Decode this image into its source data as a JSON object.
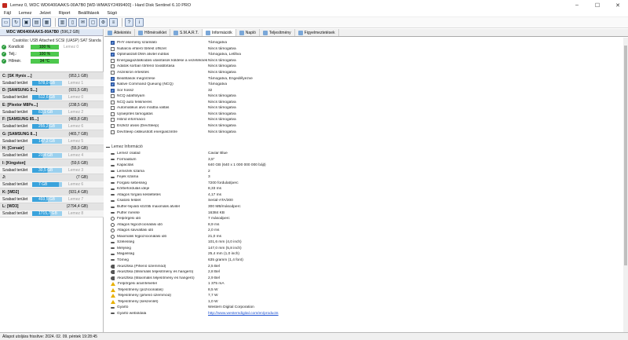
{
  "title": "Lemez 0, WDC WD6400AAKS-00A7B0 [WD-WMASY2499400]  -  Hard Disk Sentinel 6.10 PRO",
  "menu": [
    "Fájl",
    "Lemez",
    "Jelzet",
    "Riport",
    "Beállítások",
    "Súgó"
  ],
  "toolbar_icons": [
    "disk-icon",
    "refresh-icon",
    "save-icon",
    "chart-icon",
    "grid-icon",
    "report-icon",
    "book-icon",
    "mail-icon",
    "monitor-icon",
    "settings-icon",
    "list-icon",
    "help-icon",
    "info-icon"
  ],
  "disk": {
    "name": "WDC WD6400AAKS-00A7B0",
    "size": "(596,2 GB)",
    "conn": "Csatolás: USB Attached SCSI (UASP) SAT Standa",
    "stats": [
      {
        "label": "Kondíció",
        "value": "100 %",
        "extra": "Lemez 0"
      },
      {
        "label": "Telj.:",
        "value": "100 %",
        "extra": ""
      },
      {
        "label": "Hőmér.",
        "value": "34 °C",
        "extra": ""
      }
    ]
  },
  "volumes": [
    {
      "name": "C: [SK Hynix ...]",
      "size": "(953,1 GB)",
      "free": "578,0 GB",
      "disk": "Lemez 1",
      "fill": 0.61
    },
    {
      "name": "D: [SAMSUNG S...]",
      "size": "(931,5 GB)",
      "free": "512,6 GB",
      "disk": "Lemez 0",
      "fill": 0.55
    },
    {
      "name": "E: [Plextor M8Pe...]",
      "size": "(238,5 GB)",
      "free": "82,1 GB",
      "disk": "Lemez 2",
      "fill": 0.34
    },
    {
      "name": "F: [SAMSUNG 85...]",
      "size": "(465,8 GB)",
      "free": "255,2 GB",
      "disk": "Lemez 6",
      "fill": 0.55
    },
    {
      "name": "G: [SAMSUNG 8...]",
      "size": "(465,7 GB)",
      "free": "147,2 GB",
      "disk": "Lemez 5",
      "fill": 0.32
    },
    {
      "name": "H: [Corsair]",
      "size": "(55,9 GB)",
      "free": "20,4 GB",
      "disk": "Lemez 4",
      "fill": 0.36
    },
    {
      "name": "I: [Kingston]",
      "size": "(59,6 GB)",
      "free": "30,5 GB",
      "disk": "Lemez 3",
      "fill": 0.51
    },
    {
      "name": "J:",
      "size": "(7 GB)",
      "free": "7 GB",
      "disk": "Lemez 6",
      "fill": 0.9
    },
    {
      "name": "K: [WD2]",
      "size": "(931,4 GB)",
      "free": "493,5 GB",
      "disk": "Lemez 7",
      "fill": 0.53
    },
    {
      "name": "L: [WD3]",
      "size": "(2794,4 GB)",
      "free": "1715,7 GB",
      "disk": "Lemez 8",
      "fill": 0.61
    }
  ],
  "volume_free_label": "Szabad terület",
  "tabs": [
    "Áttekintés",
    "Hőmérséklet",
    "S.M.A.R.T.",
    "Információk",
    "Napló",
    "Teljesítmény",
    "Figyelmeztetések"
  ],
  "features": [
    {
      "label": "PHY esemény számláló",
      "value": "Támogatva",
      "on": true
    },
    {
      "label": "NullaIcsi ehterő törlést offszet",
      "value": "Nincs támogatva",
      "on": false
    },
    {
      "label": "Optimalizált DMA átvitel indítás",
      "value": "Támogatva, Letiltva",
      "on": true
    },
    {
      "label": "Energiagazdálkodási utasítások küldése a vezetéknek",
      "value": "Nincs támogatva",
      "on": false
    },
    {
      "label": "Adatok sorban történő továbbítása",
      "value": "Nincs támogatva",
      "on": false
    },
    {
      "label": "Aszinkron értesítés",
      "value": "Nincs támogatva",
      "on": false
    },
    {
      "label": "Beállítások megőrzése",
      "value": "Támogatva, Engedélyezve",
      "on": true
    },
    {
      "label": "Native Command Queuing (NCQ)",
      "value": "Támogatva",
      "on": true
    },
    {
      "label": "Sor hossz",
      "value": "32",
      "on": true
    },
    {
      "label": "NCQ adatfolyam",
      "value": "Nincs támogatva",
      "on": false
    },
    {
      "label": "NCQ auto felismerés",
      "value": "Nincs támogatva",
      "on": false
    },
    {
      "label": "Automatikus alvó módba váltás",
      "value": "Nincs támogatva",
      "on": false
    },
    {
      "label": "Újraépítés támogatás",
      "value": "Nincs támogatva",
      "on": false
    },
    {
      "label": "Hibrid információ",
      "value": "Nincs támogatva",
      "on": false
    },
    {
      "label": "Eszköz alvás (DevSleep)",
      "value": "Nincs támogatva",
      "on": false
    },
    {
      "label": "DevSleep ciklikusított energiaszintre",
      "value": "Nincs támogatva",
      "on": false
    }
  ],
  "section_title": "Lemez Információ",
  "info": [
    {
      "label": "Lemez család",
      "value": "Caviar Blue",
      "icon": "line"
    },
    {
      "label": "Formaátum",
      "value": "3,5\"",
      "icon": "line"
    },
    {
      "label": "Kapacitás",
      "value": "640 GB (640 x 1 000 000 000 bájt)",
      "icon": "line"
    },
    {
      "label": "Lemezek száma",
      "value": "2",
      "icon": "line"
    },
    {
      "label": "Fejek száma",
      "value": "3",
      "icon": "line"
    },
    {
      "label": "Forgási sebesség",
      "value": "7200 fordulat/perc",
      "icon": "line"
    },
    {
      "label": "Körbefordulás ideje",
      "value": "8,33 ms",
      "icon": "line"
    },
    {
      "label": "Átlagos forgási késleltetés",
      "value": "4,17 ms",
      "icon": "line"
    },
    {
      "label": "Csatoló felület",
      "value": "Serial-ATA/300",
      "icon": "line"
    },
    {
      "label": "Buffer-fejváló közötti maximális átvitel",
      "value": "300 MB/másodperc",
      "icon": "line"
    },
    {
      "label": "Puffer mérete",
      "value": "16384 KB",
      "icon": "line"
    },
    {
      "label": "Felpörgési idő",
      "value": "7 másodperc",
      "icon": "circ"
    },
    {
      "label": "Átlagos fejpozícionálási idő",
      "value": "8,9 ms",
      "icon": "circ"
    },
    {
      "label": "Átlagos sávváltási idő",
      "value": "2,0 ms",
      "icon": "circ"
    },
    {
      "label": "Maximális fejpozícionálási idő",
      "value": "21,0 ms",
      "icon": "circ"
    },
    {
      "label": "Szélesség",
      "value": "101,6 mm (4,0 inch)",
      "icon": "line"
    },
    {
      "label": "Mélység",
      "value": "147,0 mm (5,8 inch)",
      "icon": "line"
    },
    {
      "label": "Magasság",
      "value": "25,4 mm (1,0 inch)",
      "icon": "line"
    },
    {
      "label": "Tömeg",
      "value": "635 gramm (1,4 font)",
      "icon": "line"
    },
    {
      "label": "Akusztika (Pihenő üzemmód)",
      "value": "2,5 Bel",
      "icon": "spk"
    },
    {
      "label": "Akusztika (Minimális teljesítmény és hangerő)",
      "value": "2,8 Bel",
      "icon": "spk"
    },
    {
      "label": "Akusztika (Maximális teljesítmény és hangerő)",
      "value": "2,9 Bel",
      "icon": "spk"
    },
    {
      "label": "Felpörgési áramfelvétel",
      "value": "1 375 mA",
      "icon": "warn"
    },
    {
      "label": "Teljesítmény (pozícionálás)",
      "value": "8,5 W",
      "icon": "warn"
    },
    {
      "label": "Teljesítmény (pihenő üzemmód)",
      "value": "7,7 W",
      "icon": "warn"
    },
    {
      "label": "Teljesítmény (készenlét)",
      "value": "1,0 W",
      "icon": "warn"
    },
    {
      "label": "Gyártó",
      "value": "Western Digital Corporation",
      "icon": "line"
    },
    {
      "label": "Gyártó weboldala",
      "value": "http://www.westerndigital.com/en/products",
      "icon": "line",
      "link": true
    }
  ],
  "status": "Állapot utoljára frissítve: 2024. 02. 09. péntek 19:28:45"
}
